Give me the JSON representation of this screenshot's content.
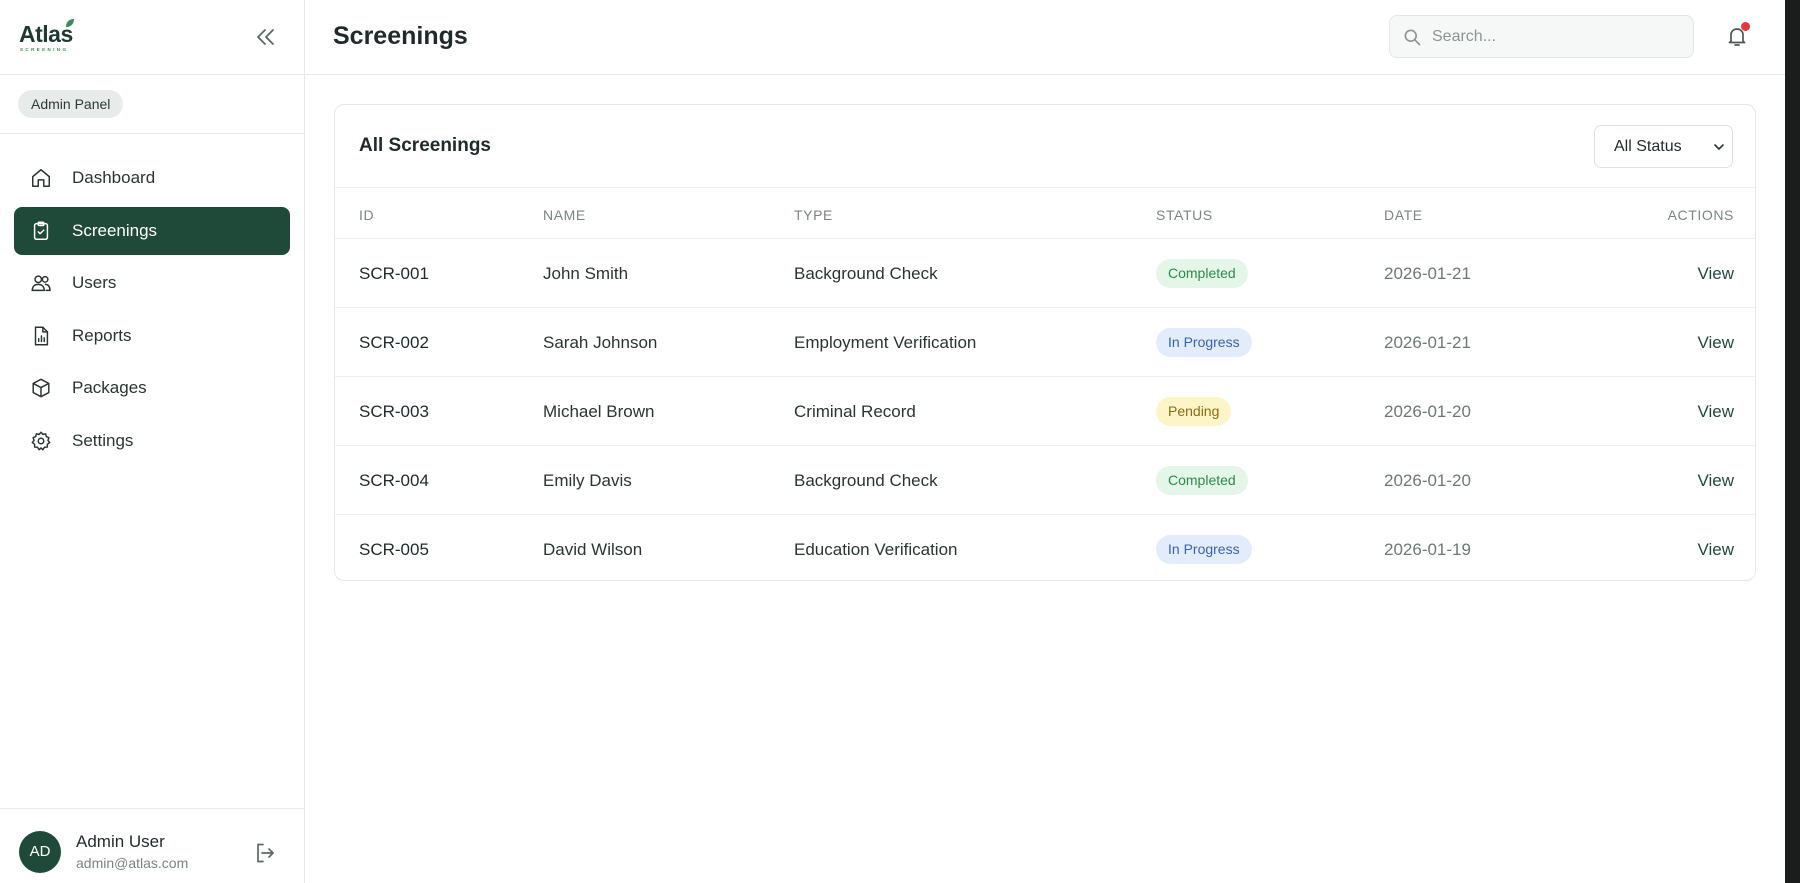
{
  "brand": {
    "name": "Atlas",
    "tagline": "SCREENING"
  },
  "sidebar": {
    "panel_badge": "Admin Panel",
    "items": [
      {
        "label": "Dashboard",
        "icon": "home-icon"
      },
      {
        "label": "Screenings",
        "icon": "clipboard-check-icon"
      },
      {
        "label": "Users",
        "icon": "users-icon"
      },
      {
        "label": "Reports",
        "icon": "report-icon"
      },
      {
        "label": "Packages",
        "icon": "package-icon"
      },
      {
        "label": "Settings",
        "icon": "gear-icon"
      }
    ],
    "active_item": "Screenings",
    "user": {
      "initials": "AD",
      "name": "Admin User",
      "email": "admin@atlas.com"
    }
  },
  "header": {
    "title": "Screenings",
    "search_placeholder": "Search...",
    "search_value": "",
    "notification_dot": true
  },
  "card": {
    "title": "All Screenings",
    "filter": {
      "selected": "All Status"
    },
    "columns": [
      "ID",
      "NAME",
      "TYPE",
      "STATUS",
      "DATE",
      "ACTIONS"
    ],
    "rows": [
      {
        "id": "SCR-001",
        "name": "John Smith",
        "type": "Background Check",
        "status": "Completed",
        "status_kind": "completed",
        "date": "2026-01-21",
        "action": "View"
      },
      {
        "id": "SCR-002",
        "name": "Sarah Johnson",
        "type": "Employment Verification",
        "status": "In Progress",
        "status_kind": "progress",
        "date": "2026-01-21",
        "action": "View"
      },
      {
        "id": "SCR-003",
        "name": "Michael Brown",
        "type": "Criminal Record",
        "status": "Pending",
        "status_kind": "pending",
        "date": "2026-01-20",
        "action": "View"
      },
      {
        "id": "SCR-004",
        "name": "Emily Davis",
        "type": "Background Check",
        "status": "Completed",
        "status_kind": "completed",
        "date": "2026-01-20",
        "action": "View"
      },
      {
        "id": "SCR-005",
        "name": "David Wilson",
        "type": "Education Verification",
        "status": "In Progress",
        "status_kind": "progress",
        "date": "2026-01-19",
        "action": "View"
      }
    ]
  },
  "colors": {
    "primary": "#1f4a3a",
    "completed_bg": "#e3f6e8",
    "progress_bg": "#e2ecfb",
    "pending_bg": "#fdf5c8",
    "notification": "#e2383f"
  }
}
